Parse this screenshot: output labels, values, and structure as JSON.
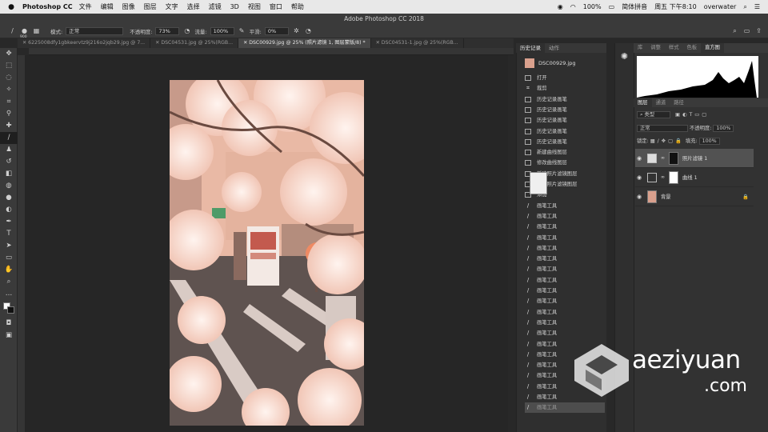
{
  "menubar": {
    "app_name": "Photoshop CC",
    "items": [
      "文件",
      "编辑",
      "图像",
      "图层",
      "文字",
      "选择",
      "滤镜",
      "3D",
      "视图",
      "窗口",
      "帮助"
    ],
    "battery": "100%",
    "input_method": "简体拼音",
    "clock": "周五 下午8:10",
    "user": "overwater"
  },
  "window_title": "Adobe Photoshop CC 2018",
  "options": {
    "brush_size": "900",
    "mode_label": "模式:",
    "mode_value": "正常",
    "opacity_label": "不透明度:",
    "opacity_value": "73%",
    "flow_label": "流量:",
    "flow_value": "100%",
    "smooth_label": "平滑:",
    "smooth_value": "0%"
  },
  "tabs": [
    "6225008dfy1gbkeervtz9j216o2jqb29.jpg @ 7...",
    "DSC04531.jpg @ 25%(RGB...",
    "DSC00929.jpg @ 25% (照片滤镜 1, 图层蒙版/8) *",
    "DSC04531-1.jpg @ 25%(RGB..."
  ],
  "history": {
    "tabs": [
      "历史记录",
      "动作"
    ],
    "snapshot": "DSC00929.jpg",
    "items": [
      {
        "icon": "doc",
        "label": "打开"
      },
      {
        "icon": "crop",
        "label": "裁剪"
      },
      {
        "icon": "doc",
        "label": "历史记录画笔"
      },
      {
        "icon": "doc",
        "label": "历史记录画笔"
      },
      {
        "icon": "doc",
        "label": "历史记录画笔"
      },
      {
        "icon": "doc",
        "label": "历史记录画笔"
      },
      {
        "icon": "doc",
        "label": "历史记录画笔"
      },
      {
        "icon": "doc",
        "label": "新建曲线图层"
      },
      {
        "icon": "doc",
        "label": "修改曲线图层"
      },
      {
        "icon": "doc",
        "label": "新建照片滤镜图层"
      },
      {
        "icon": "doc",
        "label": "修改照片滤镜图层"
      },
      {
        "icon": "doc",
        "label": "添加"
      },
      {
        "icon": "brush",
        "label": "画笔工具"
      },
      {
        "icon": "brush",
        "label": "画笔工具"
      },
      {
        "icon": "brush",
        "label": "画笔工具"
      },
      {
        "icon": "brush",
        "label": "画笔工具"
      },
      {
        "icon": "brush",
        "label": "画笔工具"
      },
      {
        "icon": "brush",
        "label": "画笔工具"
      },
      {
        "icon": "brush",
        "label": "画笔工具"
      },
      {
        "icon": "brush",
        "label": "画笔工具"
      },
      {
        "icon": "brush",
        "label": "画笔工具"
      },
      {
        "icon": "brush",
        "label": "画笔工具"
      },
      {
        "icon": "brush",
        "label": "画笔工具"
      },
      {
        "icon": "brush",
        "label": "画笔工具"
      },
      {
        "icon": "brush",
        "label": "画笔工具"
      },
      {
        "icon": "brush",
        "label": "画笔工具"
      },
      {
        "icon": "brush",
        "label": "画笔工具"
      },
      {
        "icon": "brush",
        "label": "画笔工具"
      },
      {
        "icon": "brush",
        "label": "画笔工具"
      },
      {
        "icon": "brush",
        "label": "画笔工具"
      },
      {
        "icon": "brush",
        "label": "画笔工具"
      },
      {
        "icon": "eraser",
        "label": "画笔工具"
      }
    ]
  },
  "right_panel": {
    "top_tabs": [
      "库",
      "调整",
      "样式",
      "色板",
      "直方图"
    ],
    "layer_tabs": [
      "图层",
      "通道",
      "路径"
    ],
    "filter_kind": "类型",
    "blend_mode": "正常",
    "opacity_label": "不透明度:",
    "opacity_value": "100%",
    "lock_label": "锁定:",
    "fill_label": "填充:",
    "fill_value": "100%",
    "layers": [
      {
        "name": "照片滤镜 1",
        "selected": true
      },
      {
        "name": "曲线 1",
        "selected": false
      },
      {
        "name": "背景",
        "selected": false
      }
    ]
  },
  "watermark": {
    "line1": "aeziyuan",
    "line2": ".com"
  }
}
